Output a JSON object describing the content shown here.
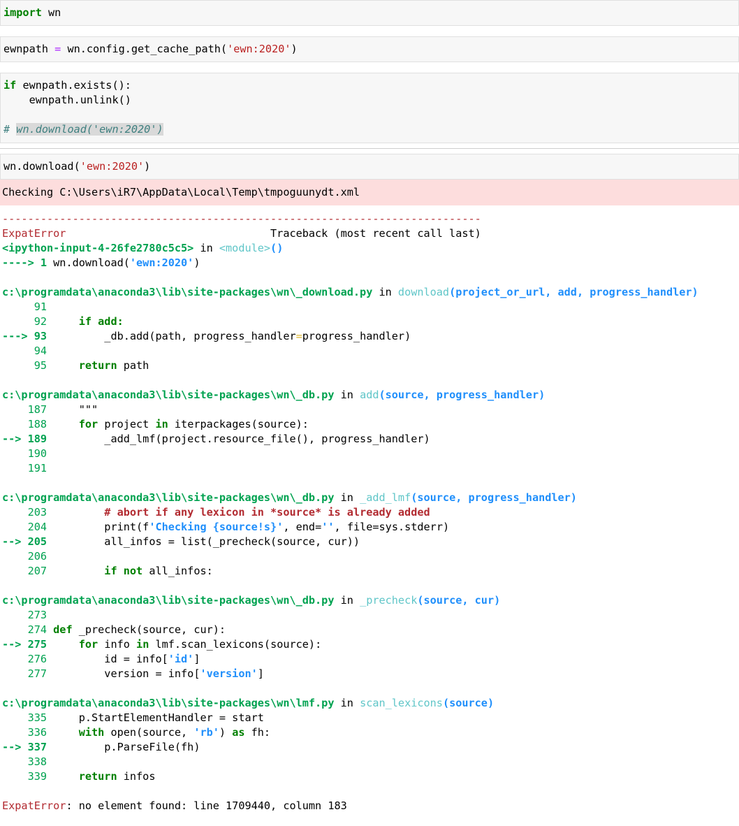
{
  "cells": {
    "c1": {
      "kw": "import",
      "rest": " wn"
    },
    "c2": {
      "var": "ewnpath ",
      "op": "=",
      "call": " wn.config.get_cache_path(",
      "str": "'ewn:2020'",
      "close": ")"
    },
    "c3": {
      "l1_kw": "if",
      "l1_rest": " ewnpath.exists():",
      "l2": "    ewnpath.unlink()",
      "l4_hash": "# ",
      "l4_sel": "wn.download('ewn:2020')"
    },
    "c4": {
      "pre": "wn.download(",
      "str": "'ewn:2020'",
      "close": ")"
    }
  },
  "stderr_text": "Checking C:\\Users\\iR7\\AppData\\Local\\Temp\\tmpoguunydt.xml",
  "traceback": {
    "dashes": "---------------------------------------------------------------------------",
    "error_name": "ExpatError",
    "header_right": "                                Traceback (most recent call last)",
    "input_file": "<ipython-input-4-26fe2780c5c5>",
    "in_word": " in ",
    "module": "<module>",
    "module_paren": "()",
    "arrow1": "----> 1",
    "arrow1_code_a": " wn.download(",
    "arrow1_str": "'ewn:2020'",
    "arrow1_close": ")",
    "frames": {
      "f1": {
        "path": "c:\\programdata\\anaconda3\\lib\\site-packages\\wn\\_download.py",
        "func": "download",
        "args": "(project_or_url, add, progress_handler)",
        "l91": "     91",
        "l92n": "     92",
        "l92code": "     if add:",
        "l93n": "---> 93",
        "l93code_a": "         _db.add(path, progress_handler",
        "l93eq": "=",
        "l93code_b": "progress_handler)",
        "l94": "     94",
        "l95n": "     95",
        "l95kw": "     return",
        "l95rest": " path"
      },
      "f2": {
        "path": "c:\\programdata\\anaconda3\\lib\\site-packages\\wn\\_db.py",
        "func": "add",
        "args": "(source, progress_handler)",
        "l187n": "    187",
        "l187code": "     \"\"\"",
        "l188n": "    188",
        "l188kw": "     for",
        "l188a": " project ",
        "l188in": "in",
        "l188b": " iterpackages(source):",
        "l189n": "--> 189",
        "l189code": "         _add_lmf(project.resource_file(), progress_handler)",
        "l190": "    190",
        "l191": "    191"
      },
      "f3": {
        "path": "c:\\programdata\\anaconda3\\lib\\site-packages\\wn\\_db.py",
        "func": "_add_lmf",
        "args": "(source, progress_handler)",
        "l203n": "    203",
        "l203code": "         # abort if any lexicon in *source* is already added",
        "l204n": "    204",
        "l204a": "         print(f",
        "l204str": "'Checking {source!s}'",
        "l204b": ", end=",
        "l204str2": "''",
        "l204c": ", file=sys.stderr)",
        "l205n": "--> 205",
        "l205code": "         all_infos = list(_precheck(source, cur))",
        "l206": "    206",
        "l207n": "    207",
        "l207kw": "         if not",
        "l207rest": " all_infos:"
      },
      "f4": {
        "path": "c:\\programdata\\anaconda3\\lib\\site-packages\\wn\\_db.py",
        "func": "_precheck",
        "args": "(source, cur)",
        "l273": "    273",
        "l274n": "    274",
        "l274kw": " def",
        "l274rest": " _precheck(source, cur):",
        "l275n": "--> 275",
        "l275kw": "     for",
        "l275a": " info ",
        "l275in": "in",
        "l275b": " lmf.scan_lexicons(source):",
        "l276n": "    276",
        "l276a": "         id = info[",
        "l276str": "'id'",
        "l276b": "]",
        "l277n": "    277",
        "l277a": "         version = info[",
        "l277str": "'version'",
        "l277b": "]"
      },
      "f5": {
        "path": "c:\\programdata\\anaconda3\\lib\\site-packages\\wn\\lmf.py",
        "func": "scan_lexicons",
        "args": "(source)",
        "l335n": "    335",
        "l335code": "     p.StartElementHandler = start",
        "l336n": "    336",
        "l336kw": "     with",
        "l336a": " open(source, ",
        "l336str": "'rb'",
        "l336b": ") ",
        "l336as": "as",
        "l336c": " fh:",
        "l337n": "--> 337",
        "l337code": "         p.ParseFile(fh)",
        "l338": "    338",
        "l339n": "    339",
        "l339kw": "     return",
        "l339rest": " infos"
      }
    },
    "final_name": "ExpatError",
    "final_msg": ": no element found: line 1709440, column 183"
  }
}
